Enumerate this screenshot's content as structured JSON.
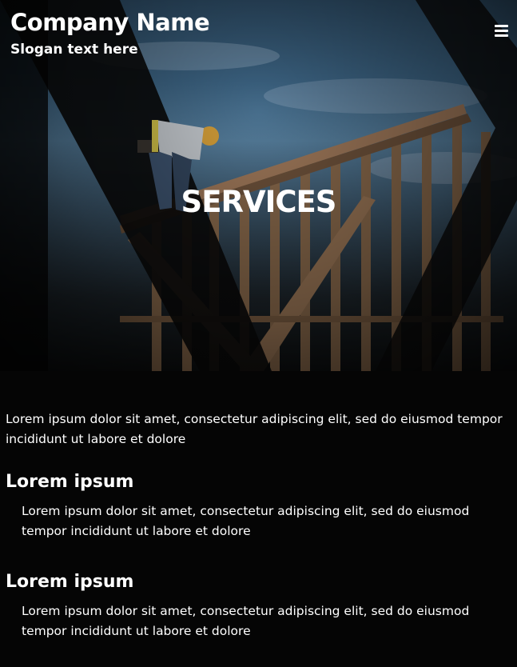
{
  "header": {
    "company_name": "Company Name",
    "slogan": "Slogan text here",
    "menu_icon": "hamburger-menu-icon"
  },
  "hero": {
    "title": "SERVICES",
    "image_subject": "construction-worker-on-wooden-frame"
  },
  "content": {
    "intro": "Lorem ipsum dolor sit amet, consectetur adipiscing elit, sed do eiusmod tempor incididunt ut labore et dolore",
    "sections": [
      {
        "title": "Lorem ipsum",
        "text": "Lorem ipsum dolor sit amet, consectetur adipiscing elit, sed do eiusmod tempor incididunt ut labore et dolore"
      },
      {
        "title": "Lorem ipsum",
        "text": "Lorem ipsum dolor sit amet, consectetur adipiscing elit, sed do eiusmod tempor incididunt ut labore et dolore"
      }
    ]
  },
  "colors": {
    "background": "#050505",
    "text": "#ffffff",
    "sky": "#57809f"
  }
}
